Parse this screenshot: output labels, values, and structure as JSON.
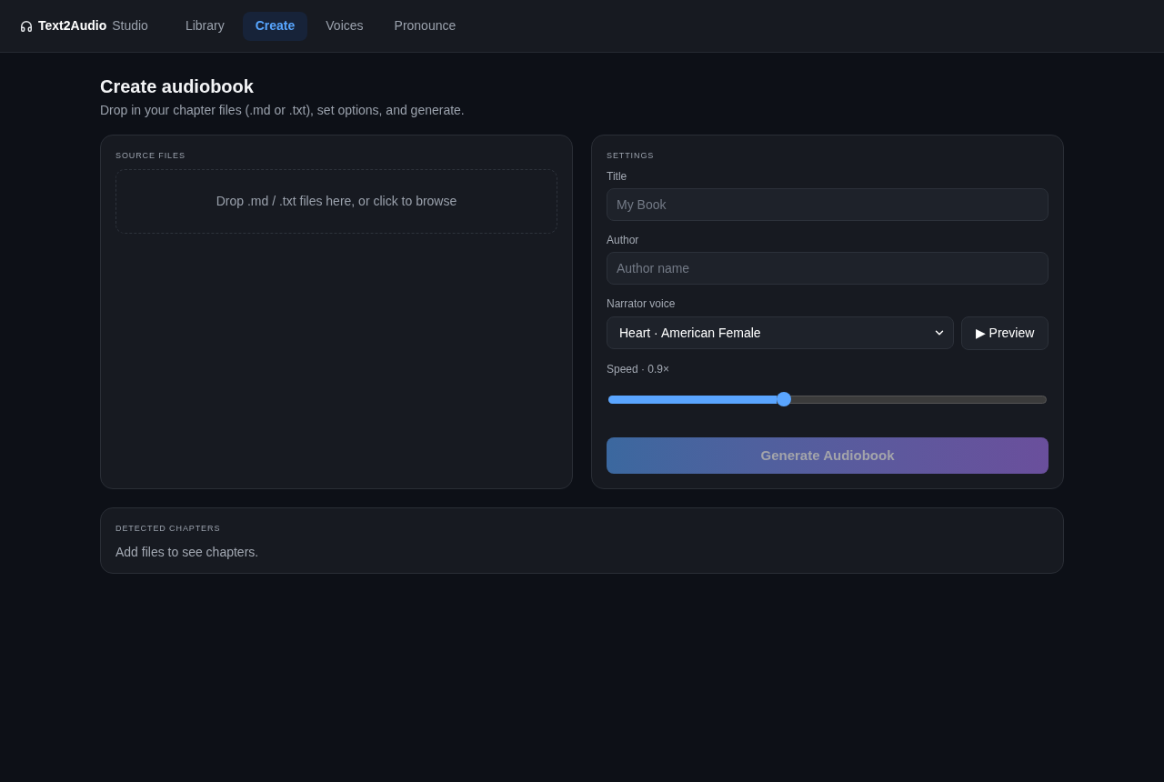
{
  "app": {
    "brand": "Text2Audio",
    "brand_suffix": "Studio"
  },
  "nav_tabs": [
    {
      "label": "Library",
      "selected": false
    },
    {
      "label": "Create",
      "selected": true
    },
    {
      "label": "Voices",
      "selected": false
    },
    {
      "label": "Pronounce",
      "selected": false
    }
  ],
  "page": {
    "title": "Create audiobook",
    "subtitle": "Drop in your chapter files (.md or .txt), set options, and generate."
  },
  "source_files": {
    "heading": "SOURCE FILES",
    "dropzone": "Drop .md / .txt files here, or click to browse"
  },
  "settings": {
    "heading": "SETTINGS",
    "title_field": {
      "label": "Title",
      "placeholder": "My Book"
    },
    "author_field": {
      "label": "Author",
      "placeholder": "Author name"
    },
    "narrator_voice": {
      "label": "Narrator voice",
      "value": "Heart · American Female"
    },
    "preview_button": "▶ Preview",
    "speed": {
      "label": "Speed · 0.9×",
      "level": 0.4
    },
    "generate_button": {
      "label": "Generate Audiobook",
      "disabled": true
    }
  },
  "detected_chapters": {
    "heading": "DETECTED CHAPTERS",
    "empty_text": "Add files to see chapters."
  }
}
